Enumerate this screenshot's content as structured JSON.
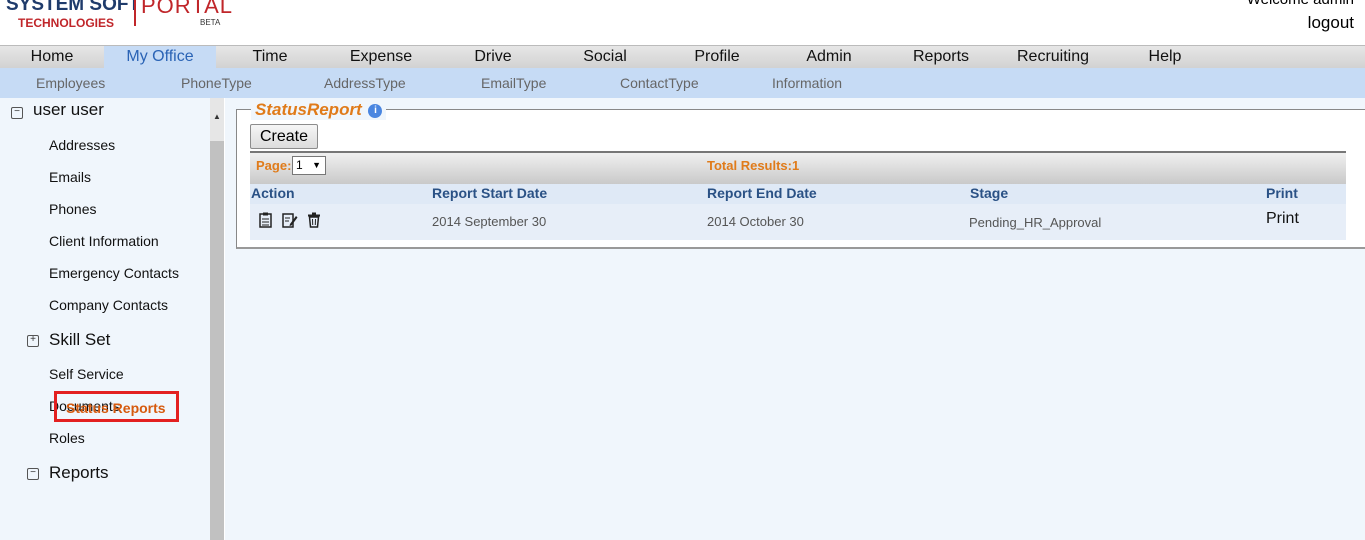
{
  "header": {
    "logo_line1": "SYSTEM SOFT",
    "logo_line2": "TECHNOLOGIES",
    "logo_portal": "PORTAL",
    "logo_beta": "BETA",
    "welcome": "Welcome admin",
    "logout": "logout"
  },
  "main_nav": [
    {
      "label": "Home"
    },
    {
      "label": "My Office",
      "active": true
    },
    {
      "label": "Time"
    },
    {
      "label": "Expense"
    },
    {
      "label": "Drive"
    },
    {
      "label": "Social"
    },
    {
      "label": "Profile"
    },
    {
      "label": "Admin"
    },
    {
      "label": "Reports"
    },
    {
      "label": "Recruiting"
    },
    {
      "label": "Help"
    }
  ],
  "sub_nav": [
    {
      "label": "Employees"
    },
    {
      "label": "PhoneType"
    },
    {
      "label": "AddressType"
    },
    {
      "label": "EmailType"
    },
    {
      "label": "ContactType"
    },
    {
      "label": "Information"
    }
  ],
  "sidebar": {
    "root_label": "user user",
    "items": [
      {
        "label": "Addresses"
      },
      {
        "label": "Emails"
      },
      {
        "label": "Phones"
      },
      {
        "label": "Client Information"
      },
      {
        "label": "Emergency Contacts"
      },
      {
        "label": "Company Contacts"
      },
      {
        "label": "Skill Set"
      },
      {
        "label": "Self Service"
      },
      {
        "label": "Documents"
      },
      {
        "label": "Roles"
      },
      {
        "label": "Reports"
      },
      {
        "label": "Status Reports",
        "selected": true
      }
    ]
  },
  "status_report": {
    "title": "StatusReport",
    "create_label": "Create",
    "page_label": "Page:",
    "page_value": "1",
    "total_results": "Total Results:1",
    "columns": [
      "Action",
      "Report Start Date",
      "Report End Date",
      "Stage",
      "Print"
    ],
    "rows": [
      {
        "start_date": "2014 September 30",
        "end_date": "2014 October 30",
        "stage": "Pending_HR_Approval",
        "print": "Print"
      }
    ]
  },
  "colors": {
    "nav_active_bg": "#c6dbf5",
    "accent_orange": "#e07b1a",
    "header_blue": "#2a5185",
    "highlight_red": "#e32020"
  }
}
